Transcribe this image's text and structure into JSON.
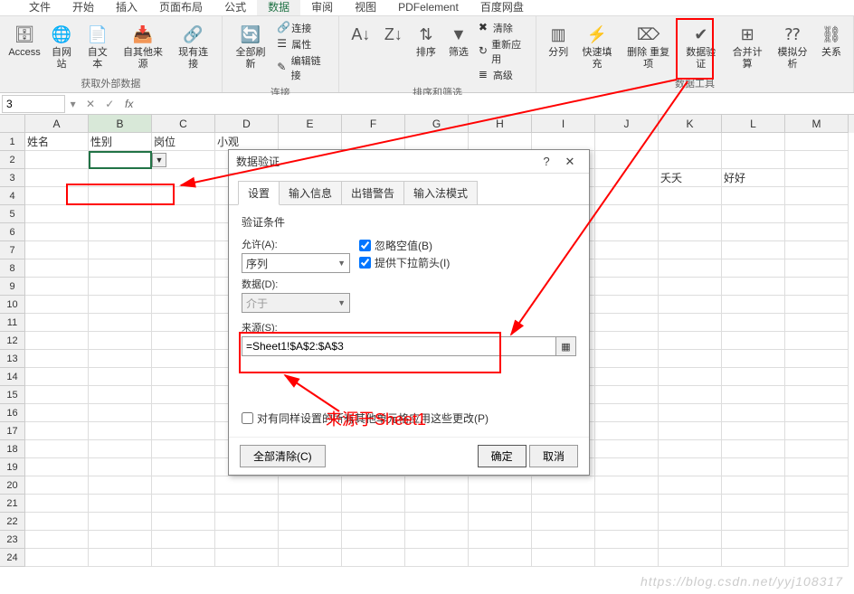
{
  "ribbon": {
    "tabs": [
      "文件",
      "开始",
      "插入",
      "页面布局",
      "公式",
      "数据",
      "审阅",
      "视图",
      "PDFelement",
      "百度网盘"
    ],
    "active_tab_index": 5,
    "groups": {
      "external": {
        "label": "获取外部数据",
        "access": "Access",
        "web": "自网站",
        "text": "自文本",
        "other": "自其他来源",
        "existing": "现有连接"
      },
      "connections": {
        "label": "连接",
        "refresh": "全部刷新",
        "conn": "连接",
        "props": "属性",
        "edit_link": "编辑链接"
      },
      "sort": {
        "sort": "排序",
        "filter": "筛选",
        "clear": "清除",
        "reapply": "重新应用",
        "advanced": "高级",
        "label": "排序和筛选"
      },
      "data_tools": {
        "text_to_columns": "分列",
        "flash_fill": "快速填充",
        "remove_duplicates": "删除\n重复项",
        "data_validation": "数据验\n证",
        "consolidate": "合并计算",
        "what_if": "模拟分析",
        "relationships": "关系",
        "label": "数据工具"
      }
    }
  },
  "formula_bar": {
    "namebox": "3",
    "fx": "fx"
  },
  "grid": {
    "columns": [
      "A",
      "B",
      "C",
      "D",
      "E",
      "F",
      "G",
      "H",
      "I",
      "J",
      "K",
      "L",
      "M"
    ],
    "row1": {
      "A": "姓名",
      "B": "性别",
      "C": "岗位",
      "D": "小观"
    },
    "row2": {
      "K": "夭夭",
      "L": "好好"
    }
  },
  "dialog": {
    "title": "数据验证",
    "tabs": [
      "设置",
      "输入信息",
      "出错警告",
      "输入法模式"
    ],
    "active_tab": 0,
    "section": "验证条件",
    "allow_label": "允许(A):",
    "allow_value": "序列",
    "data_label": "数据(D):",
    "data_value": "介于",
    "source_label": "来源(S):",
    "source_value": "=Sheet1!$A$2:$A$3",
    "ignore_blank": "忽略空值(B)",
    "dropdown_arrow": "提供下拉箭头(I)",
    "apply_all": "对有同样设置的所有其他单元格应用这些更改(P)",
    "clear_all": "全部清除(C)",
    "ok": "确定",
    "cancel": "取消"
  },
  "annotation": {
    "source_note": "来源于Sheet1"
  },
  "watermark": "https://blog.csdn.net/yyj108317"
}
